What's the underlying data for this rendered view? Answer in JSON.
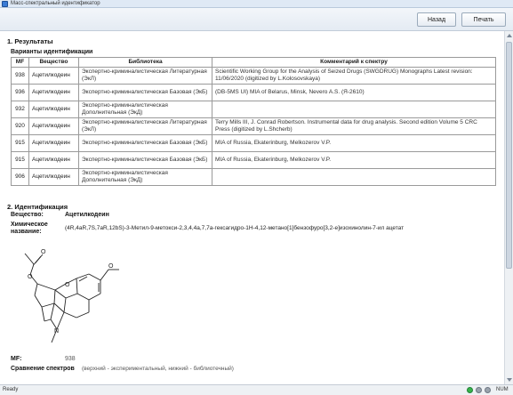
{
  "window": {
    "title": "Масс-спектральный идентификатор"
  },
  "toolbar": {
    "back_label": "Назад",
    "print_label": "Печать"
  },
  "section1": {
    "title": "1. Результаты",
    "variants_title": "Варианты идентификации",
    "columns": [
      "MF",
      "Вещество",
      "Библиотека",
      "Комментарий к спектру"
    ],
    "rows": [
      {
        "mf": "938",
        "substance": "Ацетилкодеин",
        "library": "Экспертно-криминалистическая Литературная (ЭкЛ)",
        "comment": "Scientific Working Group for the Analysis of Seized Drugs (SWGDRUG) Monographs Latest revision: 11/06/2020 (digitized by L.Kolosovskaya)"
      },
      {
        "mf": "936",
        "substance": "Ацетилкодеин",
        "library": "Экспертно-криминалистическая Базовая (ЭкБ)",
        "comment": "(DB-5MS UI) MIA of Belarus, Minsk, Nevero A.S. (Я-2610)"
      },
      {
        "mf": "932",
        "substance": "Ацетилкодеин",
        "library": "Экспертно-криминалистическая Дополнительная (ЭкД)",
        "comment": ""
      },
      {
        "mf": "920",
        "substance": "Ацетилкодеин",
        "library": "Экспертно-криминалистическая Литературная (ЭкЛ)",
        "comment": "Terry Mills III, J. Conrad Robertson. Instrumental data for drug analysis. Second edition Volume 5 CRC Press (digitized by L.Shcherb)"
      },
      {
        "mf": "915",
        "substance": "Ацетилкодеин",
        "library": "Экспертно-криминалистическая Базовая (ЭкБ)",
        "comment": "MIA of Russia, Ekaterinburg, Melkozerov V.P."
      },
      {
        "mf": "915",
        "substance": "Ацетилкодеин",
        "library": "Экспертно-криминалистическая Базовая (ЭкБ)",
        "comment": "MIA of Russia, Ekaterinburg, Melkozerov V.P."
      },
      {
        "mf": "906",
        "substance": "Ацетилкодеин",
        "library": "Экспертно-криминалистическая Дополнительная (ЭкД)",
        "comment": ""
      }
    ]
  },
  "section2": {
    "title": "2. Идентификация",
    "substance_label": "Вещество:",
    "substance_value": "Ацетилкодеин",
    "chem_name_label_1": "Химическое",
    "chem_name_label_2": "название:",
    "chem_name_value": "(4R,4aR,7S,7aR,12bS)-3-Метил-9-метокси-2,3,4,4a,7,7a-гексагидро-1H-4,12-метано[1]бензофуро[3,2-e]изохинолин-7-ил ацетат",
    "mf_label": "MF:",
    "mf_value": "938",
    "compare_label": "Сравнение спектров",
    "compare_note": "(верхний - экспериментальный, нижний - библиотечный)"
  },
  "statusbar": {
    "status": "Ready",
    "num": "NUM"
  }
}
